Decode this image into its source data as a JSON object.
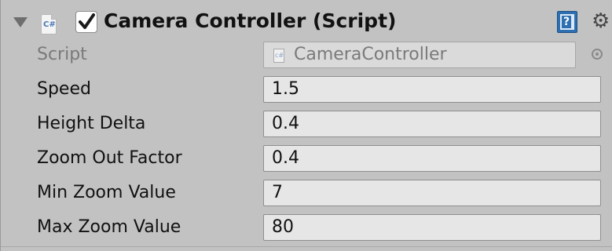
{
  "component": {
    "title": "Camera Controller (Script)",
    "enabled": true
  },
  "script_row": {
    "label": "Script",
    "value": "CameraController"
  },
  "properties": [
    {
      "label": "Speed",
      "value": "1.5"
    },
    {
      "label": "Height Delta",
      "value": "0.4"
    },
    {
      "label": "Zoom Out Factor",
      "value": "0.4"
    },
    {
      "label": "Min Zoom Value",
      "value": "7"
    },
    {
      "label": "Max Zoom Value",
      "value": "80"
    }
  ],
  "icons": {
    "foldout": "foldout-arrow-icon",
    "script": "csharp-script-icon",
    "help": "help-book-icon",
    "settings": "gear-icon",
    "picker": "object-picker-icon"
  },
  "colors": {
    "panel_bg": "#c2c2c2",
    "field_bg": "#e6e6e6",
    "help_blue": "#2e6fb2"
  }
}
